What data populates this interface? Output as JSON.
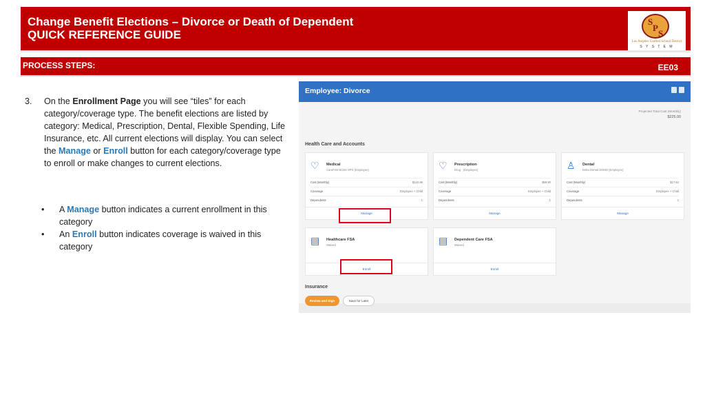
{
  "header": {
    "title_line1": "Change Benefit Elections – Divorce or Death of Dependent",
    "title_line2": "QUICK REFERENCE GUIDE",
    "logo": {
      "letters": "SPS",
      "line1": "Los Angeles Unified School District",
      "line2": "S Y S T E M"
    }
  },
  "process": {
    "label": "PROCESS STEPS:",
    "code": "EE03"
  },
  "step": {
    "number": "3.",
    "p1": "On the ",
    "enrollment_page": "Enrollment Page",
    "p2": " you will see “tiles” for each category/coverage type.  The benefit elections are listed by category: Medical, Prescription, Dental, Flexible Spending, Life Insurance, etc. All current elections will display.  You can select the ",
    "manage": "Manage",
    "or": " or ",
    "enroll": "Enroll",
    "p3": " button for each category/coverage type  to enroll or make changes to current elections."
  },
  "bullets": [
    {
      "dot": "•",
      "pre": "A ",
      "key": "Manage",
      "post": " button indicates a current enrollment in this category"
    },
    {
      "dot": "•",
      "pre": "An ",
      "key": "Enroll",
      "post": " button indicates coverage is waived in this category"
    }
  ],
  "screenshot": {
    "title": "Employee: Divorce",
    "projected_label": "Projected Total Cost (Monthly)",
    "projected_value": "$225.00",
    "section_health": "Health Care and Accounts",
    "section_insurance": "Insurance",
    "tiles": [
      {
        "name": "Medical",
        "sub": "CareFirst BCBS SPS (Employee)",
        "cost": "$142.86",
        "coverage": "Employee + Child",
        "dependents": "1",
        "button": "Manage",
        "icon": "heart-shield-icon"
      },
      {
        "name": "Prescription",
        "sub": "Drug - (Employee)",
        "cost": "$59.90",
        "coverage": "Employee + Child",
        "dependents": "1",
        "button": "Manage",
        "icon": "heart-shield-icon"
      },
      {
        "name": "Dental",
        "sub": "Delta Dental DHMO (Employee)",
        "cost": "$17.64",
        "coverage": "Employee + Child",
        "dependents": "1",
        "button": "Manage",
        "icon": "tooth-icon"
      },
      {
        "name": "Healthcare FSA",
        "sub": "Waived",
        "button": "Enroll",
        "icon": "card-icon"
      },
      {
        "name": "Dependent Care FSA",
        "sub": "Waived",
        "button": "Enroll",
        "icon": "card-icon"
      }
    ],
    "row_labels": {
      "cost": "Cost (Monthly)",
      "coverage": "Coverage",
      "dependents": "Dependents"
    },
    "review_button": "Review and Sign",
    "save_button": "Save for Later"
  }
}
